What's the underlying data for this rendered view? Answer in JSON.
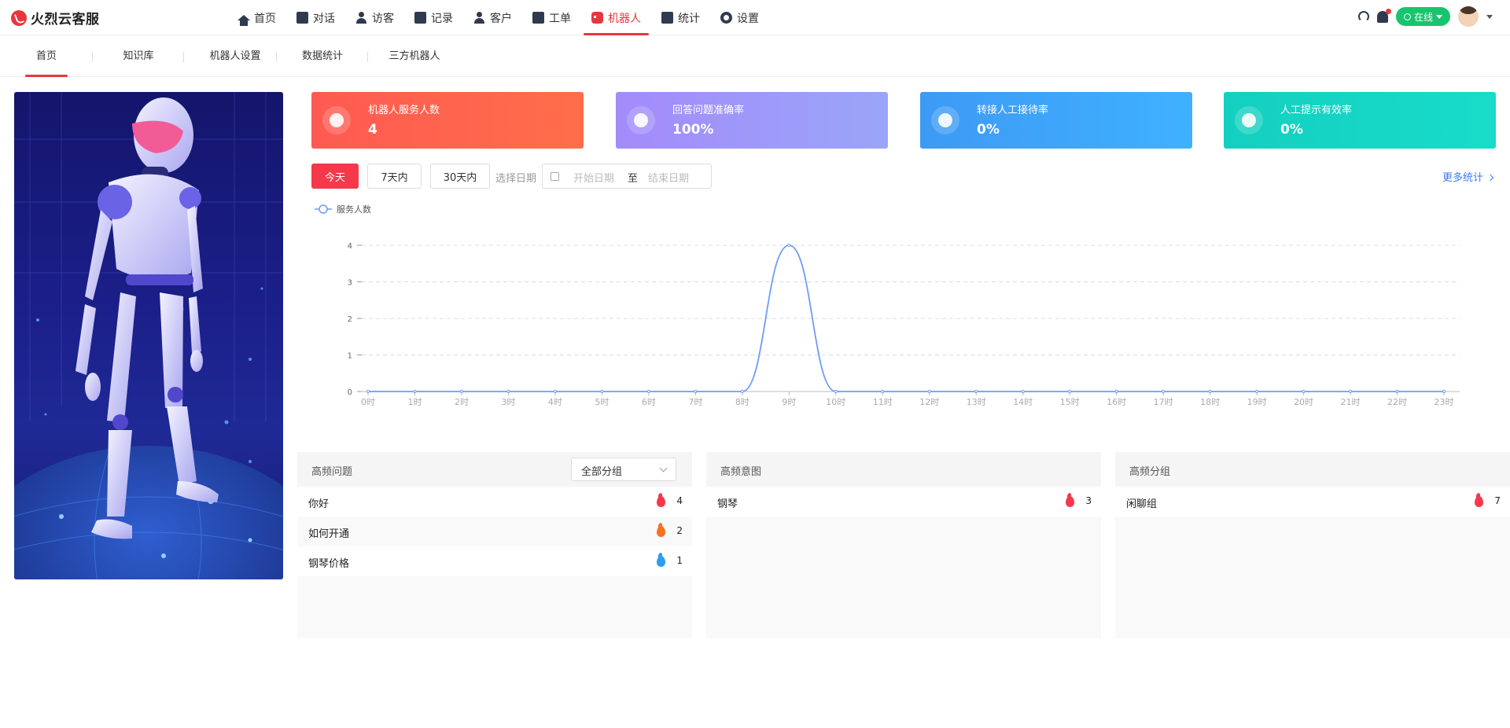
{
  "brand": {
    "name": "火烈云客服"
  },
  "nav": {
    "items": [
      {
        "label": "首页",
        "icon": "home-icon"
      },
      {
        "label": "对话",
        "icon": "chat-icon"
      },
      {
        "label": "访客",
        "icon": "visitor-icon"
      },
      {
        "label": "记录",
        "icon": "record-icon"
      },
      {
        "label": "客户",
        "icon": "customer-icon"
      },
      {
        "label": "工单",
        "icon": "ticket-icon"
      },
      {
        "label": "机器人",
        "icon": "robot-icon",
        "active": true
      },
      {
        "label": "统计",
        "icon": "stats-icon"
      },
      {
        "label": "设置",
        "icon": "gear-icon"
      }
    ]
  },
  "header_right": {
    "status": "在线"
  },
  "subtabs": [
    {
      "label": "首页",
      "active": true
    },
    {
      "label": "知识库"
    },
    {
      "label": "机器人设置"
    },
    {
      "label": "数据统计"
    },
    {
      "label": "三方机器人"
    }
  ],
  "stats": [
    {
      "label": "机器人服务人数",
      "value": "4",
      "color_from": "#ff5a52",
      "color_to": "#ff6e4a"
    },
    {
      "label": "回答问题准确率",
      "value": "100%",
      "color_from": "#a38bfa",
      "color_to": "#9aa5f8"
    },
    {
      "label": "转接人工接待率",
      "value": "0%",
      "color_from": "#3d9af5",
      "color_to": "#3fb1ff"
    },
    {
      "label": "人工提示有效率",
      "value": "0%",
      "color_from": "#14cfc0",
      "color_to": "#18dcc9"
    }
  ],
  "filters": {
    "today": "今天",
    "d7": "7天内",
    "d30": "30天内",
    "select_date": "选择日期",
    "start_placeholder": "开始日期",
    "separator": "至",
    "end_placeholder": "结束日期",
    "more": "更多统计"
  },
  "chart_data": {
    "type": "line",
    "legend": [
      "服务人数"
    ],
    "legend_position": "top-left",
    "x": [
      "0时",
      "1时",
      "2时",
      "3时",
      "4时",
      "5时",
      "6时",
      "7时",
      "8时",
      "9时",
      "10时",
      "11时",
      "12时",
      "13时",
      "14时",
      "15时",
      "16时",
      "17时",
      "18时",
      "19时",
      "20时",
      "21时",
      "22时",
      "23时"
    ],
    "series": [
      {
        "name": "服务人数",
        "values": [
          0,
          0,
          0,
          0,
          0,
          0,
          0,
          0,
          0,
          4,
          0,
          0,
          0,
          0,
          0,
          0,
          0,
          0,
          0,
          0,
          0,
          0,
          0,
          0
        ],
        "color": "#6d9cf6"
      }
    ],
    "yticks": [
      0,
      1,
      2,
      3,
      4
    ],
    "ylim": [
      0,
      4
    ],
    "grid": true,
    "smooth": true
  },
  "panels": {
    "faq": {
      "title": "高频问题",
      "select": "全部分组",
      "rows": [
        {
          "label": "你好",
          "count": "4",
          "flame": "#f5394a"
        },
        {
          "label": "如何开通",
          "count": "2",
          "flame": "#f5731e"
        },
        {
          "label": "钢琴价格",
          "count": "1",
          "flame": "#2d9cf0"
        }
      ]
    },
    "intent": {
      "title": "高频意图",
      "rows": [
        {
          "label": "钢琴",
          "count": "3",
          "flame": "#f5394a"
        }
      ]
    },
    "group": {
      "title": "高频分组",
      "rows": [
        {
          "label": "闲聊组",
          "count": "7",
          "flame": "#f5394a"
        }
      ]
    }
  }
}
